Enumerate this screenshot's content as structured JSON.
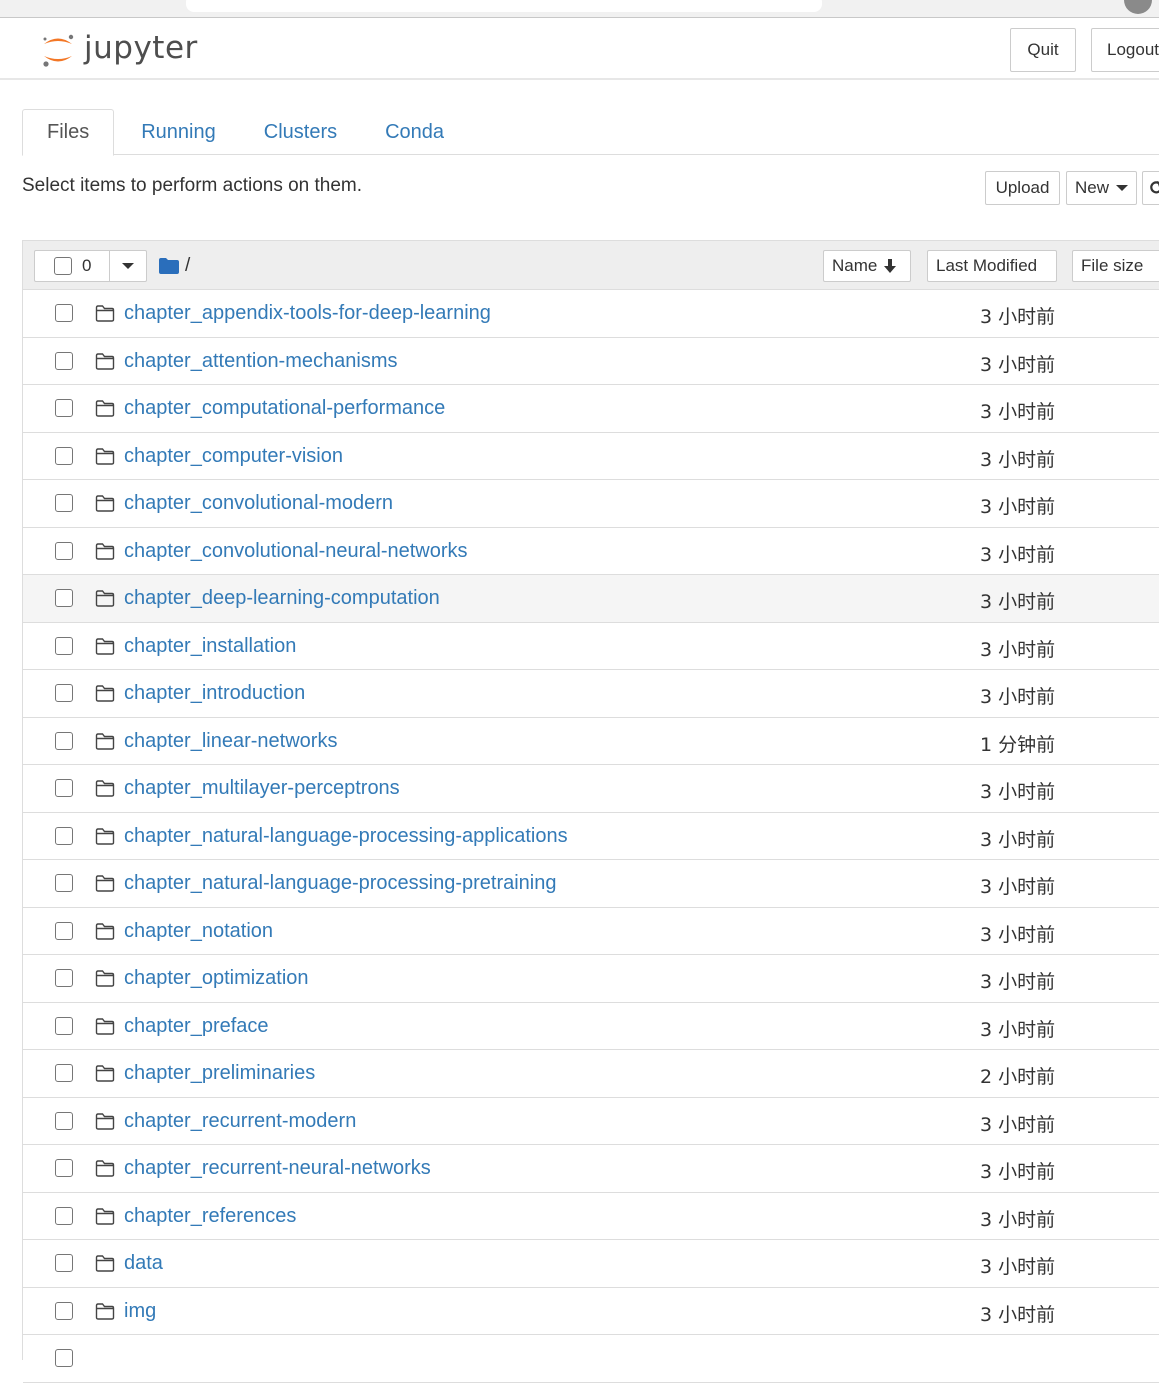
{
  "header": {
    "logo_text": "jupyter",
    "quit_label": "Quit",
    "logout_label": "Logout"
  },
  "tabs": [
    {
      "label": "Files",
      "active": true
    },
    {
      "label": "Running",
      "active": false
    },
    {
      "label": "Clusters",
      "active": false
    },
    {
      "label": "Conda",
      "active": false
    }
  ],
  "toolbar": {
    "hint": "Select items to perform actions on them.",
    "upload_label": "Upload",
    "new_label": "New"
  },
  "list_header": {
    "selected_count": "0",
    "path": "/",
    "sort_name_label": "Name",
    "sort_name_icon": "arrow-down-icon",
    "sort_modified_label": "Last Modified",
    "sort_size_label": "File size"
  },
  "colors": {
    "link": "#337ab7",
    "logo_orange": "#f37726",
    "header_bg": "#eeeeee"
  },
  "rows": [
    {
      "name": "chapter_appendix-tools-for-deep-learning",
      "modified": "3 小时前",
      "icon": "folder-icon"
    },
    {
      "name": "chapter_attention-mechanisms",
      "modified": "3 小时前",
      "icon": "folder-icon"
    },
    {
      "name": "chapter_computational-performance",
      "modified": "3 小时前",
      "icon": "folder-icon"
    },
    {
      "name": "chapter_computer-vision",
      "modified": "3 小时前",
      "icon": "folder-icon"
    },
    {
      "name": "chapter_convolutional-modern",
      "modified": "3 小时前",
      "icon": "folder-icon"
    },
    {
      "name": "chapter_convolutional-neural-networks",
      "modified": "3 小时前",
      "icon": "folder-icon"
    },
    {
      "name": "chapter_deep-learning-computation",
      "modified": "3 小时前",
      "icon": "folder-icon",
      "hover": true
    },
    {
      "name": "chapter_installation",
      "modified": "3 小时前",
      "icon": "folder-icon"
    },
    {
      "name": "chapter_introduction",
      "modified": "3 小时前",
      "icon": "folder-icon"
    },
    {
      "name": "chapter_linear-networks",
      "modified": "1 分钟前",
      "icon": "folder-icon"
    },
    {
      "name": "chapter_multilayer-perceptrons",
      "modified": "3 小时前",
      "icon": "folder-icon"
    },
    {
      "name": "chapter_natural-language-processing-applications",
      "modified": "3 小时前",
      "icon": "folder-icon"
    },
    {
      "name": "chapter_natural-language-processing-pretraining",
      "modified": "3 小时前",
      "icon": "folder-icon"
    },
    {
      "name": "chapter_notation",
      "modified": "3 小时前",
      "icon": "folder-icon"
    },
    {
      "name": "chapter_optimization",
      "modified": "3 小时前",
      "icon": "folder-icon"
    },
    {
      "name": "chapter_preface",
      "modified": "3 小时前",
      "icon": "folder-icon"
    },
    {
      "name": "chapter_preliminaries",
      "modified": "2 小时前",
      "icon": "folder-icon"
    },
    {
      "name": "chapter_recurrent-modern",
      "modified": "3 小时前",
      "icon": "folder-icon"
    },
    {
      "name": "chapter_recurrent-neural-networks",
      "modified": "3 小时前",
      "icon": "folder-icon"
    },
    {
      "name": "chapter_references",
      "modified": "3 小时前",
      "icon": "folder-icon"
    },
    {
      "name": "data",
      "modified": "3 小时前",
      "icon": "folder-icon"
    },
    {
      "name": "img",
      "modified": "3 小时前",
      "icon": "folder-icon"
    }
  ]
}
